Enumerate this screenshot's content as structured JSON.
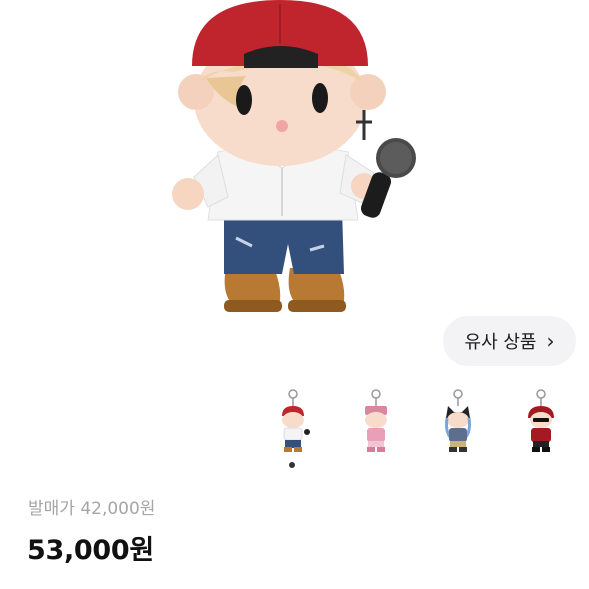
{
  "similar_button": {
    "label": "유사 상품",
    "chevron": "chevron-right-icon"
  },
  "gallery": {
    "thumbnails": [
      {
        "name": "keyring-red-cap",
        "accent": "#b8232b"
      },
      {
        "name": "keyring-pink-hat",
        "accent": "#e8a0b8"
      },
      {
        "name": "keyring-black-cat-ears",
        "accent": "#222222"
      },
      {
        "name": "keyring-red-hood-sunglasses",
        "accent": "#a31a22"
      }
    ],
    "active_index": 0
  },
  "price": {
    "original": "발매가 42,000원",
    "current": "53,000원"
  }
}
